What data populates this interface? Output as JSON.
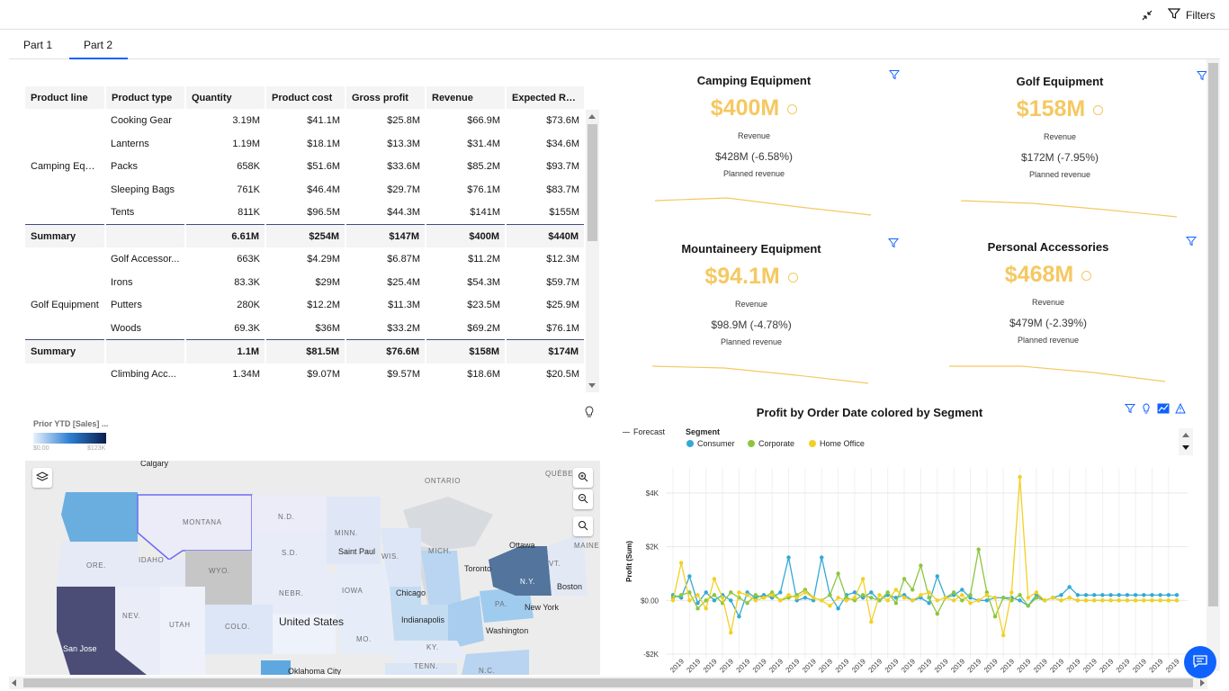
{
  "toolbar": {
    "filters_label": "Filters"
  },
  "tabs": [
    {
      "label": "Part 1"
    },
    {
      "label": "Part 2"
    }
  ],
  "crosstab": {
    "headers": [
      "Product line",
      "Product type",
      "Quantity",
      "Product cost",
      "Gross profit",
      "Revenue",
      "Expected Re..."
    ],
    "rows": [
      [
        "",
        "Cooking Gear",
        "3.19M",
        "$41.1M",
        "$25.8M",
        "$66.9M",
        "$73.6M"
      ],
      [
        "",
        "Lanterns",
        "1.19M",
        "$18.1M",
        "$13.3M",
        "$31.4M",
        "$34.6M"
      ],
      [
        "Camping Equi...",
        "Packs",
        "658K",
        "$51.6M",
        "$33.6M",
        "$85.2M",
        "$93.7M"
      ],
      [
        "",
        "Sleeping Bags",
        "761K",
        "$46.4M",
        "$29.7M",
        "$76.1M",
        "$83.7M"
      ],
      [
        "",
        "Tents",
        "811K",
        "$96.5M",
        "$44.3M",
        "$141M",
        "$155M"
      ],
      [
        "Summary",
        "",
        "6.61M",
        "$254M",
        "$147M",
        "$400M",
        "$440M"
      ],
      [
        "",
        "Golf Accessor...",
        "663K",
        "$4.29M",
        "$6.87M",
        "$11.2M",
        "$12.3M"
      ],
      [
        "",
        "Irons",
        "83.3K",
        "$29M",
        "$25.4M",
        "$54.3M",
        "$59.7M"
      ],
      [
        "Golf Equipment",
        "Putters",
        "280K",
        "$12.2M",
        "$11.3M",
        "$23.5M",
        "$25.9M"
      ],
      [
        "",
        "Woods",
        "69.3K",
        "$36M",
        "$33.2M",
        "$69.2M",
        "$76.1M"
      ],
      [
        "Summary",
        "",
        "1.1M",
        "$81.5M",
        "$76.6M",
        "$158M",
        "$174M"
      ],
      [
        "",
        "Climbing Acc...",
        "1.34M",
        "$9.07M",
        "$9.57M",
        "$18.6M",
        "$20.5M"
      ]
    ]
  },
  "kpis": [
    {
      "title": "Camping Equipment",
      "value": "$400M",
      "value_label": "Revenue",
      "planned": "$428M (-6.58%)",
      "planned_label": "Planned revenue"
    },
    {
      "title": "Golf Equipment",
      "value": "$158M",
      "value_label": "Revenue",
      "planned": "$172M (-7.95%)",
      "planned_label": "Planned revenue"
    },
    {
      "title": "Mountaineery Equipment",
      "value": "$94.1M",
      "value_label": "Revenue",
      "planned": "$98.9M (-4.78%)",
      "planned_label": "Planned revenue"
    },
    {
      "title": "Personal Accessories",
      "value": "$468M",
      "value_label": "Revenue",
      "planned": "$479M (-2.39%)",
      "planned_label": "Planned revenue"
    }
  ],
  "map": {
    "legend_title": "Prior YTD [Sales] ...",
    "legend_min": "$0.00",
    "legend_max": "$123K",
    "labels": {
      "calgary": "Calgary",
      "ontario": "ONTARIO",
      "quebec": "QUÉBE",
      "montana": "MONTANA",
      "nd": "N.D.",
      "minn": "MINN.",
      "sd": "S.D.",
      "ore": "ORE.",
      "idaho": "IDAHO",
      "wyo": "WYO.",
      "wis": "WIS.",
      "mich": "MICH.",
      "ottawa": "Ottawa",
      "vt": "VT.",
      "maine": "MAINE",
      "saint_paul": "Saint Paul",
      "toronto": "Toronto",
      "ny": "N.Y.",
      "nebr": "NEBR.",
      "iowa": "IOWA",
      "chicago": "Chicago",
      "boston": "Boston",
      "pa": "PA.",
      "new_york": "New York",
      "nev": "NEV.",
      "utah": "UTAH",
      "colo": "COLO.",
      "us": "United States",
      "indianapolis": "Indianapolis",
      "washington": "Washington",
      "mo": "MO.",
      "ky": "KY.",
      "san_jose": "San Jose",
      "tenn": "TENN.",
      "nc": "N.C.",
      "okc": "Oklahoma City"
    }
  },
  "line_chart": {
    "title": "Profit by Order Date colored by Segment",
    "forecast_label": "Forecast",
    "legend_title": "Segment",
    "ylabel": "Profit (Sum)",
    "tick_label": "2019"
  },
  "chart_data": {
    "type": "line",
    "title": "Profit by Order Date colored by Segment",
    "ylabel": "Profit (Sum)",
    "ylim": [
      -2000,
      5000
    ],
    "yticks": [
      "-$2K",
      "$0.00",
      "$2K",
      "$4K"
    ],
    "colors": {
      "Consumer": "#33a9d6",
      "Corporate": "#8cc63f",
      "Home Office": "#f2d024"
    },
    "series": [
      {
        "name": "Consumer",
        "values": [
          200,
          100,
          900,
          -100,
          300,
          0,
          200,
          0,
          -600,
          300,
          100,
          200,
          100,
          300,
          1600,
          0,
          100,
          0,
          1600,
          200,
          -300,
          200,
          300,
          100,
          300,
          0,
          200,
          100,
          200,
          0,
          100,
          -100,
          900,
          100,
          200,
          400,
          100,
          0,
          0,
          100,
          100,
          100,
          0,
          -200,
          200,
          0,
          100,
          200,
          500,
          200,
          200,
          200,
          200,
          200,
          200,
          200,
          200,
          200,
          200,
          200,
          200,
          200
        ]
      },
      {
        "name": "Corporate",
        "values": [
          100,
          200,
          300,
          -300,
          0,
          200,
          -100,
          300,
          100,
          -100,
          200,
          100,
          300,
          0,
          100,
          200,
          400,
          100,
          0,
          200,
          1000,
          100,
          0,
          200,
          100,
          0,
          300,
          -100,
          800,
          400,
          1300,
          100,
          -500,
          100,
          300,
          0,
          200,
          1900,
          300,
          -600,
          100,
          0,
          200,
          -200,
          100,
          0,
          100,
          0,
          100,
          0,
          0,
          0,
          0,
          0,
          0,
          0,
          0,
          0,
          0,
          0,
          0,
          0
        ]
      },
      {
        "name": "Home Office",
        "values": [
          0,
          1400,
          0,
          200,
          -300,
          800,
          100,
          -1200,
          300,
          200,
          0,
          100,
          200,
          0,
          200,
          100,
          300,
          100,
          0,
          -200,
          100,
          0,
          100,
          800,
          -800,
          200,
          0,
          400,
          100,
          0,
          200,
          300,
          0,
          100,
          0,
          200,
          -100,
          0,
          200,
          100,
          -1300,
          300,
          4600,
          100,
          300,
          0,
          100,
          0,
          100,
          0,
          0,
          0,
          0,
          0,
          0,
          0,
          0,
          0,
          0,
          0,
          0,
          0
        ]
      }
    ]
  }
}
